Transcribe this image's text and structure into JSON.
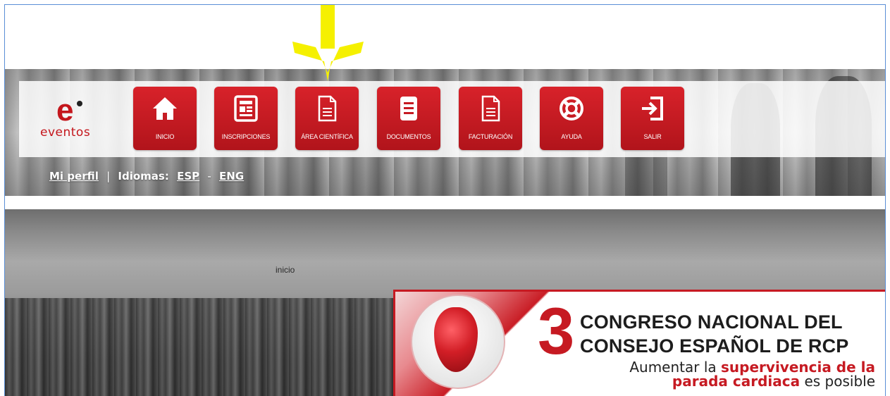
{
  "logo": {
    "mark": "e",
    "word": "eventos"
  },
  "nav": [
    {
      "label": "INICIO",
      "icon": "home-icon"
    },
    {
      "label": "INSCRIPCIONES",
      "icon": "form-icon"
    },
    {
      "label": "ÁREA CIENTÍFICA",
      "icon": "document-icon"
    },
    {
      "label": "DOCUMENTOS",
      "icon": "list-document-icon"
    },
    {
      "label": "FACTURACIÓN",
      "icon": "invoice-icon"
    },
    {
      "label": "AYUDA",
      "icon": "lifebuoy-icon"
    },
    {
      "label": "SALIR",
      "icon": "exit-icon"
    }
  ],
  "profile": {
    "my_profile": "Mi perfil",
    "separator": "|",
    "languages_label": "Idiomas:",
    "lang_esp": "ESP",
    "dash": "-",
    "lang_eng": "ENG"
  },
  "breadcrumb": "inicio",
  "banner": {
    "number": "3",
    "line1": "CONGRESO NACIONAL DEL",
    "line2": "CONSEJO ESPAÑOL DE RCP",
    "tag_pre": "Aumentar la ",
    "tag_red1": "supervivencia de la",
    "tag_red2": "parada cardiaca",
    "tag_post": " es posible"
  },
  "colors": {
    "brand_red": "#c61a22",
    "arrow_yellow": "#f5f000",
    "frame_blue": "#5b8fd6"
  }
}
